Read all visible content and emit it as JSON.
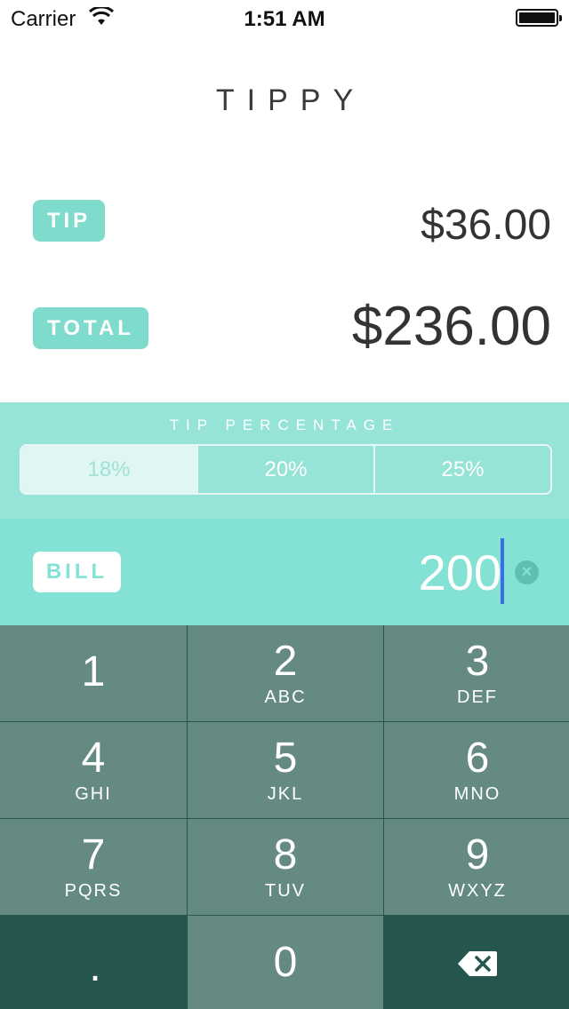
{
  "status_bar": {
    "carrier": "Carrier",
    "time": "1:51 AM"
  },
  "app": {
    "title": "TIPPY"
  },
  "results": {
    "tip_label": "TIP",
    "tip_amount": "$36.00",
    "total_label": "TOTAL",
    "total_amount": "$236.00"
  },
  "tip_percentage": {
    "heading": "TIP PERCENTAGE",
    "options": [
      "18%",
      "20%",
      "25%"
    ],
    "selected": "18%"
  },
  "bill": {
    "label": "BILL",
    "value": "200"
  },
  "keypad": {
    "keys": [
      {
        "digit": "1",
        "letters": ""
      },
      {
        "digit": "2",
        "letters": "ABC"
      },
      {
        "digit": "3",
        "letters": "DEF"
      },
      {
        "digit": "4",
        "letters": "GHI"
      },
      {
        "digit": "5",
        "letters": "JKL"
      },
      {
        "digit": "6",
        "letters": "MNO"
      },
      {
        "digit": "7",
        "letters": "PQRS"
      },
      {
        "digit": "8",
        "letters": "TUV"
      },
      {
        "digit": "9",
        "letters": "WXYZ"
      }
    ],
    "decimal": ".",
    "zero": "0",
    "backspace_icon": "backspace-icon"
  },
  "colors": {
    "accent": "#7fdccd",
    "percentage_panel": "#96e3d7",
    "bill_panel": "#84e2d4",
    "keypad_key": "#658a82",
    "keypad_dark": "#24564e",
    "caret": "#3a6ee8"
  }
}
